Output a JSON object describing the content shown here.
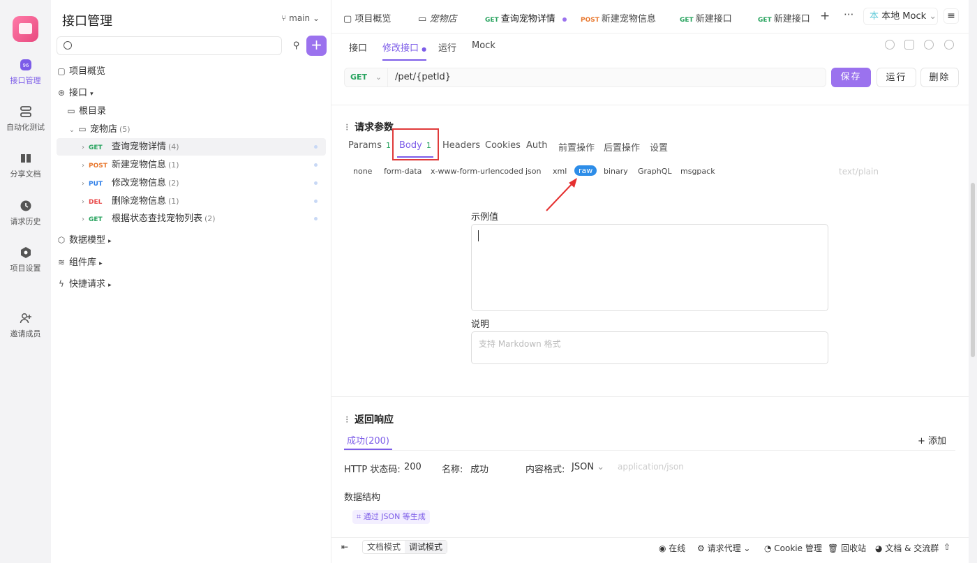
{
  "rail": {
    "items": [
      {
        "label": "接口管理",
        "icon": "api-icon"
      },
      {
        "label": "自动化测试",
        "icon": "automation-icon"
      },
      {
        "label": "分享文档",
        "icon": "book-icon"
      },
      {
        "label": "请求历史",
        "icon": "clock-icon"
      },
      {
        "label": "项目设置",
        "icon": "settings-icon"
      },
      {
        "label": "邀请成员",
        "icon": "add-user-icon"
      }
    ]
  },
  "sidebar": {
    "title": "接口管理",
    "branch": "main",
    "overview": "项目概览",
    "api_root": "接口",
    "root_dir": "根目录",
    "folder": {
      "name": "宠物店",
      "count": "(5)"
    },
    "apis": [
      {
        "method": "GET",
        "name": "查询宠物详情",
        "count": "(4)"
      },
      {
        "method": "POST",
        "name": "新建宠物信息",
        "count": "(1)"
      },
      {
        "method": "PUT",
        "name": "修改宠物信息",
        "count": "(2)"
      },
      {
        "method": "DEL",
        "name": "删除宠物信息",
        "count": "(1)"
      },
      {
        "method": "GET",
        "name": "根据状态查找宠物列表",
        "count": "(2)"
      }
    ],
    "models": "数据模型",
    "components": "组件库",
    "quick": "快捷请求"
  },
  "tabs": [
    {
      "method": "",
      "label": "项目概览"
    },
    {
      "method": "",
      "label": "宠物店"
    },
    {
      "method": "GET",
      "label": "查询宠物详情"
    },
    {
      "method": "POST",
      "label": "新建宠物信息"
    },
    {
      "method": "GET",
      "label": "新建接口"
    },
    {
      "method": "GET",
      "label": "新建接口"
    }
  ],
  "env": {
    "label": "本地 Mock"
  },
  "subtabs": [
    "接口",
    "修改接口",
    "运行",
    "Mock"
  ],
  "request": {
    "method": "GET",
    "path": "/pet/{petId}"
  },
  "buttons": {
    "save": "保存",
    "run": "运行",
    "delete": "删除"
  },
  "params": {
    "title": "请求参数",
    "tabs": [
      {
        "label": "Params",
        "count": "1"
      },
      {
        "label": "Body",
        "count": "1"
      },
      {
        "label": "Headers",
        "count": ""
      },
      {
        "label": "Cookies",
        "count": ""
      },
      {
        "label": "Auth",
        "count": ""
      },
      {
        "label": "前置操作",
        "count": ""
      },
      {
        "label": "后置操作",
        "count": ""
      },
      {
        "label": "设置",
        "count": ""
      }
    ],
    "body_types": [
      "none",
      "form-data",
      "x-www-form-urlencoded",
      "json",
      "xml",
      "raw",
      "binary",
      "GraphQL",
      "msgpack"
    ],
    "content_type": "text/plain",
    "example_label": "示例值",
    "desc_label": "说明",
    "desc_placeholder": "支持 Markdown 格式"
  },
  "response": {
    "title": "返回响应",
    "tab": "成功(200)",
    "add": "添加",
    "status_label": "HTTP 状态码:",
    "status_value": "200",
    "name_label": "名称:",
    "name_value": "成功",
    "format_label": "内容格式:",
    "format_value": "JSON",
    "format_mime": "application/json",
    "schema_label": "数据结构",
    "generate": "通过 JSON 等生成"
  },
  "statusbar": {
    "doc_mode": "文档模式",
    "debug_mode": "调试模式",
    "online": "在线",
    "proxy": "请求代理",
    "cookie": "Cookie 管理",
    "trash": "回收站",
    "community": "文档 & 交流群"
  }
}
